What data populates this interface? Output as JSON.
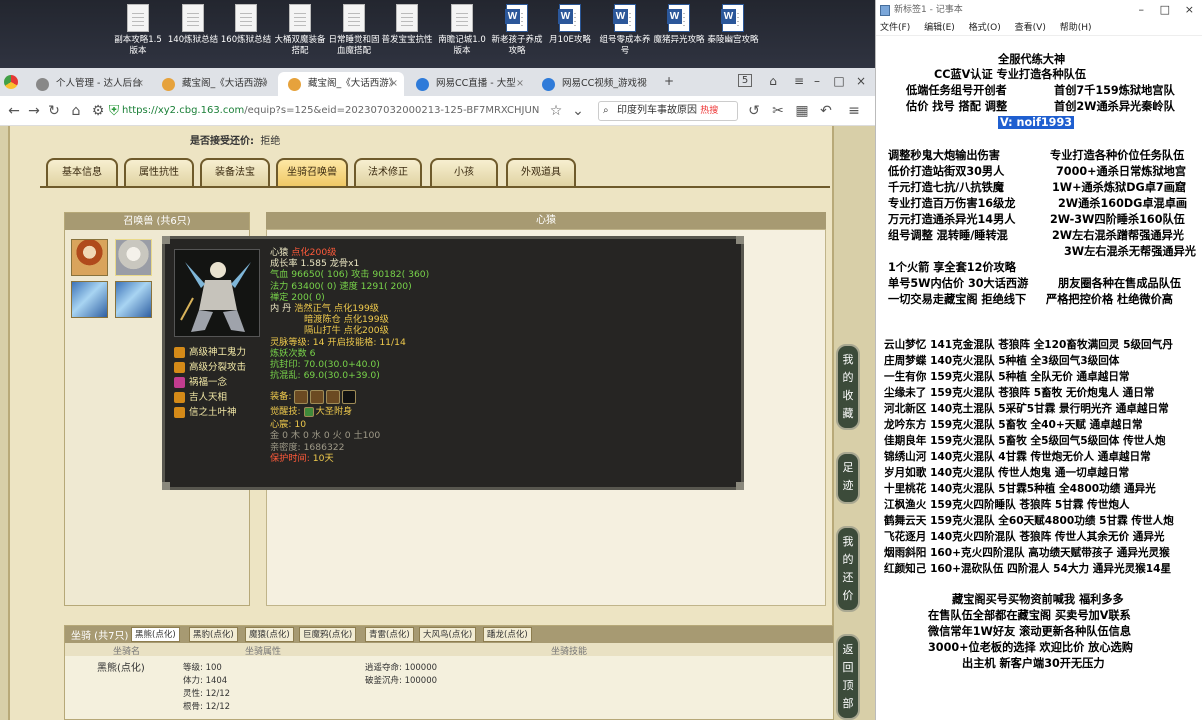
{
  "desktop_icons": [
    {
      "label": "副本攻略1.5版本",
      "type": "doc"
    },
    {
      "label": "140炼狱总结",
      "type": "doc"
    },
    {
      "label": "160炼狱总结",
      "type": "doc"
    },
    {
      "label": "大桶双魔装备搭配",
      "type": "doc"
    },
    {
      "label": "日常睡觉和固血魔搭配",
      "type": "doc"
    },
    {
      "label": "普发宝宝抗性",
      "type": "doc"
    },
    {
      "label": "南瞻记城1.0版本",
      "type": "doc"
    },
    {
      "label": "新老孩子养成攻略",
      "type": "word"
    },
    {
      "label": "月10E攻略",
      "type": "word"
    },
    {
      "label": "组号零成本养号",
      "type": "word"
    },
    {
      "label": "魔猪异光攻略",
      "type": "word"
    },
    {
      "label": "秦陵幽宫攻略",
      "type": "word"
    }
  ],
  "browser": {
    "tabs": [
      {
        "label": "个人管理 - 达人后台",
        "favicon_color": "#888888",
        "active": false
      },
      {
        "label": "藏宝阁_《大话西游》",
        "favicon_color": "#e6a23c",
        "active": false
      },
      {
        "label": "藏宝阁_《大话西游》",
        "favicon_color": "#e6a23c",
        "active": true
      },
      {
        "label": "网易CC直播 - 大型",
        "favicon_color": "#2f7bd9",
        "active": false
      },
      {
        "label": "网易CC视频_游戏视",
        "favicon_color": "#2f7bd9",
        "active": false
      }
    ],
    "tab_count": "5",
    "url_scheme_host": "https://xy2.cbg.163.com",
    "url_path": "/equip?s=125&eid=202307032000213-125-BF7MRXCHJUN",
    "search_text": "印度列车事故原因",
    "search_hot": "热搜"
  },
  "page": {
    "offer_label": "是否接受还价:",
    "offer_value": "拒绝",
    "tabs": [
      "基本信息",
      "属性抗性",
      "装备法宝",
      "坐骑召唤兽",
      "法术修正",
      "小孩",
      "外观道具"
    ],
    "active_tab": "坐骑召唤兽",
    "pet_list_title": "召唤兽 (共6只)",
    "detail_title": "心猿"
  },
  "popup": {
    "name": "心猿",
    "reborn": "点化200级",
    "growth": "成长率 1.585 龙骨x1",
    "hp": "气血 96650( 106) 攻击 90182( 360)",
    "mp": "法力 63400( 0) 速度 1291( 200)",
    "zen": "禅定 200( 0)",
    "dan_label": "内   丹",
    "dan1": "浩然正气 点化199级",
    "dan2": "暗渡陈仓 点化199级",
    "dan3": "隔山打牛 点化200级",
    "spirit_level": "灵脉等级:  14  开启技能格:  11/14",
    "refine": "炼妖次数 6",
    "resist_seal": "抗封印: 70.0(30.0+40.0)",
    "resist_chaos": "抗混乱: 69.0(30.0+39.0)",
    "equip_label": "装备:",
    "awaken_label": "觉醒技:",
    "awaken_value": "大圣附身",
    "friend_label": "心宸:",
    "friend_value": "10",
    "elements": "金 0 木 0 水 0 火 0 土100",
    "intimacy": "亲密度: 1686322",
    "protect_label": "保护时间:",
    "protect_value": "10天",
    "skills": [
      "高级神工鬼力",
      "高级分裂攻击",
      "祸福一念",
      "吉人天相",
      "信之土叶神"
    ]
  },
  "mount": {
    "title": "坐骑 (共7只)",
    "tabs": [
      "黑熊(点化)",
      "黑豹(点化)",
      "魔猿(点化)",
      "巨魔鸦(点化)",
      "青雷(点化)",
      "大风鸟(点化)",
      "蹯龙(点化)"
    ],
    "columns": [
      "坐骑名",
      "坐骑属性",
      "坐骑技能"
    ],
    "name": "黑熊(点化)",
    "attrs": [
      "等级: 100",
      "体力: 1404",
      "灵性: 12/12",
      "根骨: 12/12"
    ],
    "skills": [
      "逍遥夺命: 100000",
      "破釜沉舟: 100000"
    ]
  },
  "side_buttons": [
    "我的收藏",
    "足迹",
    "我的还价",
    "返回顶部"
  ],
  "notepad": {
    "title": "新标签1 - 记事本",
    "menu": [
      "文件(F)",
      "编辑(E)",
      "格式(O)",
      "查看(V)",
      "帮助(H)"
    ],
    "lines_top": [
      "全服代练大神",
      "CC蓝V认证 专业打造各种队伍",
      "低端任务组号开创者",
      "首创7千159炼狱地宫队",
      "估价 找号 搭配 调整",
      "首创2W通杀异光秦岭队"
    ],
    "highlight": "V:  noif1993",
    "lines_mid_left": [
      "调整秒鬼大炮输出伤害",
      "低价打造站街双30男人",
      "千元打造七抗/八抗铁魔",
      "专业打造百万伤害16级龙",
      "万元打造通杀异光14男人",
      "组号调整 混转睡/睡转混"
    ],
    "lines_mid_right": [
      "专业打造各种价位任务队伍",
      "7000+通杀日常炼狱地宫",
      "1W+通杀炼狱DG卓7画窟",
      "2W通杀160DG卓混卓画",
      "2W-3W四阶睡杀160队伍",
      "2W左右混杀蹭帮强通异光",
      "3W左右混杀无帮强通异光"
    ],
    "lines_offer": [
      "1个火箭 享全套12价攻略",
      "单号5W内估价 30大话西游",
      "一切交易走藏宝阁 拒绝线下"
    ],
    "lines_offer_right": [
      "朋友圈各种在售成品队伍",
      "严格把控价格 杜绝微价高"
    ],
    "lines_customers": [
      "云山梦忆 141克金混队 苍狼阵 全120畜牧满回灵 5级回气丹",
      "庄周梦蝶 140克火混队 5种植 全3级回气3级回体",
      "一生有你 159克火混队 5种植 全队无价 通卓越日常",
      "尘缘未了 159克火混队 苍狼阵 5畜牧 无价炮鬼人 通日常",
      "河北新区 140克土混队 5采矿5甘霖 景行明光齐 通卓越日常",
      "龙吟东方 159克火混队 5畜牧 全40+天赋 通卓越日常",
      "佳期良年 159克火混队 5畜牧 全5级回气5级回体 传世人炮",
      "锦绣山河 140克火混队 4甘霖 传世炮无价人 通卓越日常",
      "岁月如歌 140克火混队 传世人炮鬼 通一切卓越日常",
      "十里桃花 140克火混队 5甘霖5种植 全4800功绩 通异光",
      "江枫渔火 159克火四阶睡队 苍狼阵 5甘霖 传世炮人",
      "鹤舞云天 159克火混队 全60天赋4800功绩 5甘霖 传世人炮",
      "飞花逐月 140克火四阶混队 苍狼阵 传世人其余无价 通异光",
      "烟雨斜阳 160+克火四阶混队 高功绩天赋带孩子 通异光灵猴",
      "红颜知己 160+混砍队伍 四阶混人 54大力 通异光灵猴14星"
    ],
    "lines_bottom": [
      "藏宝阁买号买物资前喊我 福利多多",
      "在售队伍全部都在藏宝阁 买卖号加V联系",
      "微信常年1W好友 滚动更新各种队伍信息",
      "3000+位老板的选择 欢迎比价 放心选购",
      "出主机 新客户端30开无压力"
    ]
  }
}
